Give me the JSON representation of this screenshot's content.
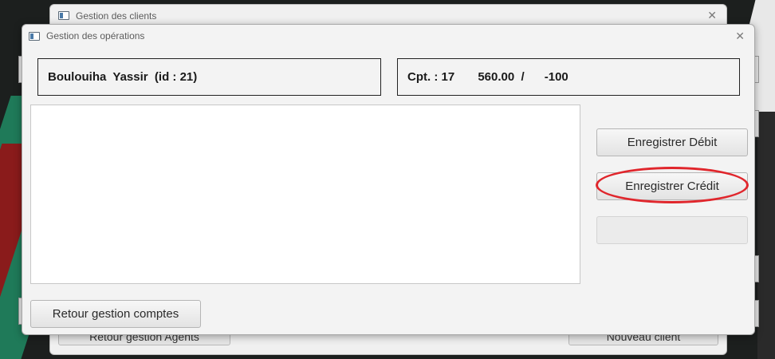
{
  "back_window": {
    "title": "Gestion des clients",
    "close_glyph": "✕",
    "left_button_label": "Retour gestion Agents",
    "right_button_label": "Nouveau client"
  },
  "front_window": {
    "title": "Gestion des opérations",
    "close_glyph": "✕",
    "client_info": "Boulouiha  Yassir  (id : 21)",
    "account_info": "Cpt. : 17       560.00  /      -100",
    "buttons": {
      "debit": "Enregistrer Débit",
      "credit": "Enregistrer Crédit",
      "empty": "",
      "return": "Retour gestion comptes"
    }
  },
  "annotation": {
    "color": "#e0262c",
    "target": "Enregistrer Crédit"
  },
  "icons": {
    "window": "window-app-icon",
    "close": "close-icon"
  }
}
